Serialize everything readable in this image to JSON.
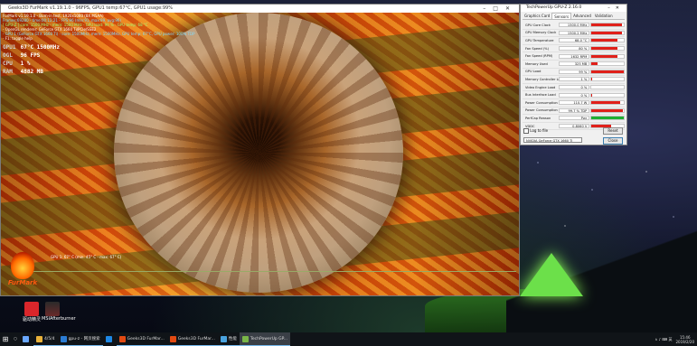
{
  "furmark": {
    "title": "Geeks3D FurMark v1.19.1.0 - 96FPS, GPU1 temp:67°C, GPU1 usage:99%",
    "hud_lines": [
      "FurMark v1.19.1.0 - Burn-in test, 1920x1080 (8X MSAA)",
      "Frames:69280 - time:00:12:21 - FPS:96 (min:91, max:99, avg:96)",
      "[ GPU-Z ] core: 1500 MHz - mem: 1500 MHz - GPU load: 99 % - GPU temp: 68 °C",
      "- OpenGL renderer: GeForce GTX 1660 Ti/PCIe/SSE2",
      "- GPU 1 (GeForce GTX 1660 Ti) - core: 1500MHz, mem: 1500MHz, GPU temp: 67°C, GPU power: 100% TDP",
      "- F1: toggle help"
    ],
    "stats": [
      {
        "label": "GPU1",
        "value": "67°C  1500MHz"
      },
      {
        "label": "OGL",
        "value": "96 FPS"
      },
      {
        "label": "CPU",
        "value": "1 %"
      },
      {
        "label": "RAM",
        "value": "4882 MB"
      }
    ],
    "gpu_graph_label": "GPU 1: 67° C (min: 45° C - max: 67° C)",
    "logo_text": "FurMark"
  },
  "desktop_icons": [
    {
      "label": "驱动精灵",
      "color": "#d9262b"
    },
    {
      "label": "MSIAfterburner",
      "color": "#3a3a3a"
    }
  ],
  "gpuz": {
    "title": "TechPowerUp GPU-Z 2.16.0",
    "tabs": [
      "Graphics Card",
      "Sensors",
      "Advanced",
      "Validation"
    ],
    "active_tab": "Sensors",
    "rows": [
      {
        "name": "GPU Core Clock",
        "value": "1500.0 MHz",
        "level": 0.95,
        "color": "#e0201a"
      },
      {
        "name": "GPU Memory Clock",
        "value": "1500.2 MHz",
        "level": 0.95,
        "color": "#e0201a"
      },
      {
        "name": "GPU Temperature",
        "value": "68.0 °C",
        "level": 0.8,
        "color": "#e0201a"
      },
      {
        "name": "Fan Speed (%)",
        "value": "80 %",
        "level": 0.8,
        "color": "#e0201a"
      },
      {
        "name": "Fan Speed (RPM)",
        "value": "1632 RPM",
        "level": 0.8,
        "color": "#e0201a"
      },
      {
        "name": "Memory Used",
        "value": "325 MB",
        "level": 0.2,
        "color": "#e0201a"
      },
      {
        "name": "GPU Load",
        "value": "99 %",
        "level": 0.99,
        "color": "#e0201a"
      },
      {
        "name": "Memory Controller Load",
        "value": "1 %",
        "level": 0.02,
        "color": "#e0201a"
      },
      {
        "name": "Video Engine Load",
        "value": "0 %",
        "level": 0.0,
        "color": "#e0201a"
      },
      {
        "name": "Bus Interface Load",
        "value": "0 %",
        "level": 0.02,
        "color": "#e0201a"
      },
      {
        "name": "Power Consumption (W)",
        "value": "110.7 W",
        "level": 0.9,
        "color": "#e0201a"
      },
      {
        "name": "Power Consumption (%)",
        "value": "99.7 % TDP",
        "level": 0.97,
        "color": "#e0201a"
      },
      {
        "name": "PerfCap Reason",
        "value": "Pwr",
        "level": 1.0,
        "color": "#1fae32"
      },
      {
        "name": "VDDC",
        "value": "0.8060 V",
        "level": 0.6,
        "color": "#e0201a"
      }
    ],
    "log_label": "Log to file",
    "reset_label": "Reset",
    "device": "NVIDIA GeForce GTX 1660 Ti",
    "close_label": "Close"
  },
  "taskbar": {
    "items": [
      {
        "label": "",
        "color": "#6aa8ff",
        "state": "none"
      },
      {
        "label": "4/5/4",
        "color": "#e9b23a",
        "state": "open"
      },
      {
        "label": "gpu-z - 网页搜索",
        "color": "#2b7cd3",
        "state": "open"
      },
      {
        "label": "",
        "color": "#1e88e5",
        "state": "none"
      },
      {
        "label": "Geeks3D FurMar...",
        "color": "#e34a12",
        "state": "open"
      },
      {
        "label": "Geeks3D FurMar...",
        "color": "#e34a12",
        "state": "open"
      },
      {
        "label": "性能",
        "color": "#4aa3df",
        "state": "open"
      },
      {
        "label": "TechPowerUp GP...",
        "color": "#7ab648",
        "state": "active"
      }
    ],
    "tray_icons": "∧  ♪  ⌨  英",
    "time": "15:46",
    "date": "2019/2/20"
  }
}
